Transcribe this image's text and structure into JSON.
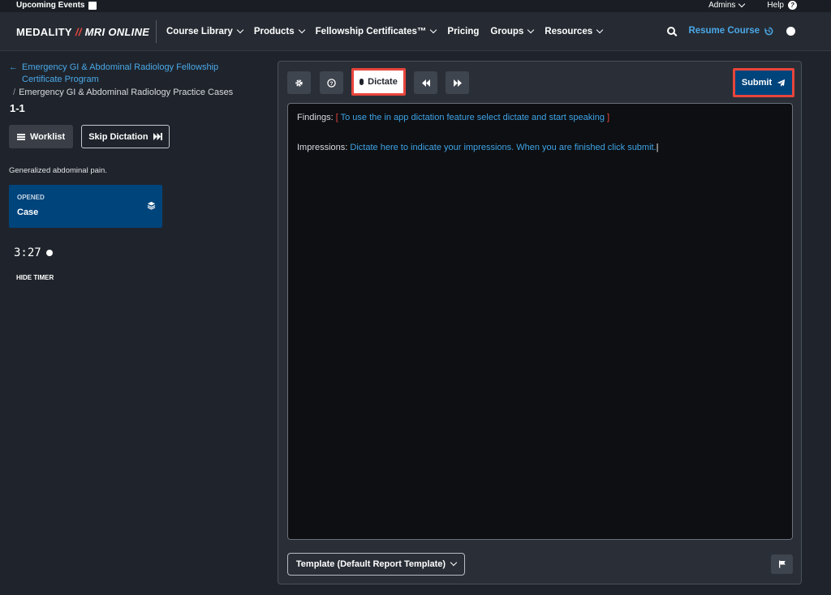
{
  "topbar": {
    "events": "Upcoming Events",
    "admins": "Admins",
    "help": "Help"
  },
  "nav": {
    "logo_left": "MEDALITY",
    "logo_right": "MRI ONLINE",
    "items": [
      "Course Library",
      "Products",
      "Fellowship Certificates™",
      "Pricing",
      "Groups",
      "Resources"
    ],
    "resume": "Resume Course"
  },
  "left": {
    "back_link": "Emergency GI & Abdominal Radiology Fellowship Certificate Program",
    "breadcrumb": "Emergency GI & Abdominal Radiology Practice Cases",
    "case_id": "1-1",
    "worklist": "Worklist",
    "skip": "Skip Dictation",
    "history": "Generalized abdominal pain.",
    "card_label": "OPENED",
    "card_value": "Case",
    "timer": "3:27",
    "hide_timer": "HIDE TIMER"
  },
  "panel": {
    "dictate": "Dictate",
    "submit": "Submit",
    "findings_label": "Findings:",
    "findings_text": "To use the in app dictation feature select dictate and start speaking",
    "impressions_label": "Impressions:",
    "impressions_text": "Dictate here to indicate your impressions.  When you are finished click submit.",
    "template": "Template (Default Report Template)"
  },
  "colors": {
    "accent": "#3fa3e6",
    "highlight": "#e8453c",
    "submit_bg": "#00447c"
  }
}
